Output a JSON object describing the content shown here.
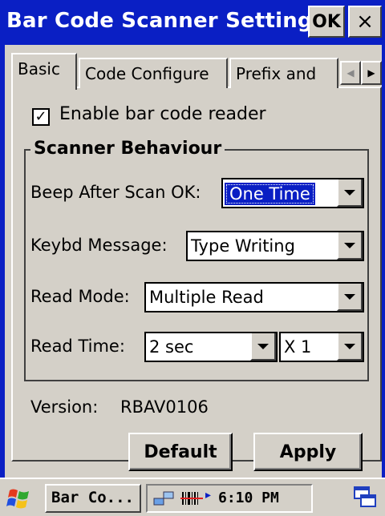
{
  "window": {
    "title": "Bar Code Scanner Settings",
    "ok_label": "OK",
    "close_label": "×"
  },
  "tabs": [
    {
      "label": "Basic",
      "active": true
    },
    {
      "label": "Code Configure",
      "active": false
    },
    {
      "label": "Prefix and",
      "active": false
    }
  ],
  "tab_scroll": {
    "left_icon": "chevron-left-icon",
    "right_icon": "chevron-right-icon"
  },
  "enable_reader": {
    "label": "Enable bar code reader",
    "checked": true,
    "mark": "✓"
  },
  "scanner_behaviour": {
    "title": "Scanner Behaviour",
    "beep": {
      "label": "Beep After Scan OK:",
      "value": "One Time"
    },
    "keybd": {
      "label": "Keybd Message:",
      "value": "Type Writing"
    },
    "read_mode": {
      "label": "Read Mode:",
      "value": "Multiple Read"
    },
    "read_time": {
      "label": "Read Time:",
      "value": "2 sec",
      "multiplier": "X 1"
    }
  },
  "version": {
    "label": "Version:",
    "value": "RBAV0106"
  },
  "buttons": {
    "default_label": "Default",
    "apply_label": "Apply"
  },
  "taskbar": {
    "task_label": "Bar Co...",
    "clock": "6:10 PM",
    "tray_arrow": "▸"
  },
  "colors": {
    "title_bar": "#0a1fc4",
    "selection": "#0a1fc4",
    "face": "#d4d0c8"
  }
}
